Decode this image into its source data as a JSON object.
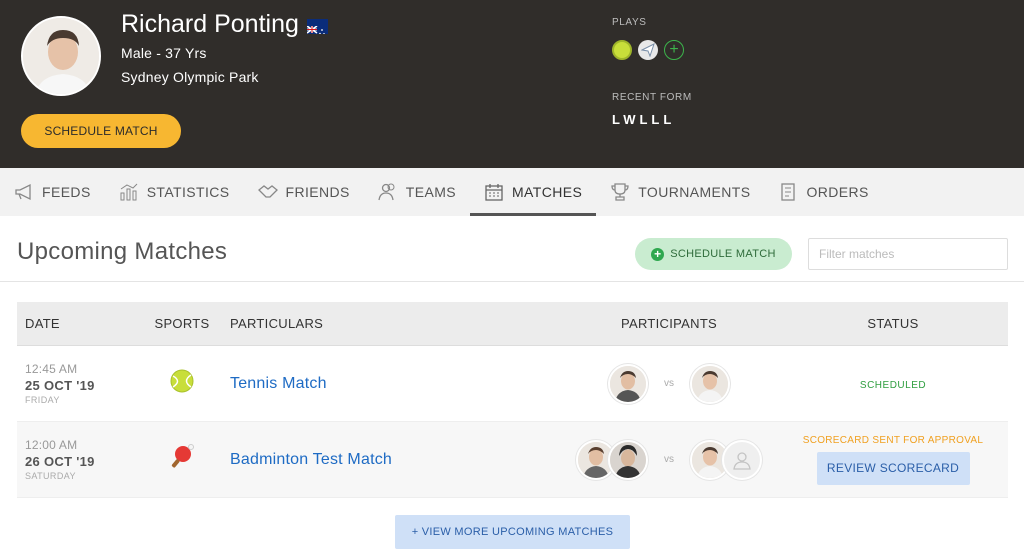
{
  "profile": {
    "name": "Richard Ponting",
    "meta": "Male - 37 Yrs",
    "location": "Sydney Olympic Park",
    "schedule_label": "SCHEDULE MATCH",
    "plays_label": "PLAYS",
    "plays_icons": [
      "tennis-ball-icon",
      "paper-plane-icon",
      "add-sport-icon"
    ],
    "form_label": "RECENT FORM",
    "form_value": "LWLLL"
  },
  "tabs": [
    {
      "label": "FEEDS",
      "icon": "megaphone-icon"
    },
    {
      "label": "STATISTICS",
      "icon": "bar-chart-icon"
    },
    {
      "label": "FRIENDS",
      "icon": "handshake-icon"
    },
    {
      "label": "TEAMS",
      "icon": "users-icon"
    },
    {
      "label": "MATCHES",
      "icon": "calendar-icon",
      "active": true
    },
    {
      "label": "TOURNAMENTS",
      "icon": "trophy-icon"
    },
    {
      "label": "ORDERS",
      "icon": "receipt-icon"
    }
  ],
  "main": {
    "title": "Upcoming Matches",
    "schedule_label": "SCHEDULE MATCH",
    "filter_placeholder": "Filter matches",
    "columns": [
      "DATE",
      "SPORTS",
      "PARTICULARS",
      "PARTICIPANTS",
      "STATUS"
    ],
    "rows": [
      {
        "time": "12:45 AM",
        "date": "25 OCT '19",
        "weekday": "FRIDAY",
        "sport_icon": "tennis-ball-icon",
        "title": "Tennis Match",
        "vs": "vs",
        "status": "SCHEDULED"
      },
      {
        "time": "12:00 AM",
        "date": "26 OCT '19",
        "weekday": "SATURDAY",
        "sport_icon": "ping-pong-icon",
        "title": "Badminton Test Match",
        "vs": "vs",
        "status": "SCORECARD SENT FOR APPROVAL",
        "action": "REVIEW SCORECARD"
      }
    ],
    "more_label": "+ VIEW MORE UPCOMING MATCHES"
  },
  "colors": {
    "header_bg": "#302d2a",
    "accent_yellow": "#f7b731",
    "link_blue": "#1e6bc4",
    "scheduled_green": "#2e9e3f",
    "approval_orange": "#f0a020"
  }
}
